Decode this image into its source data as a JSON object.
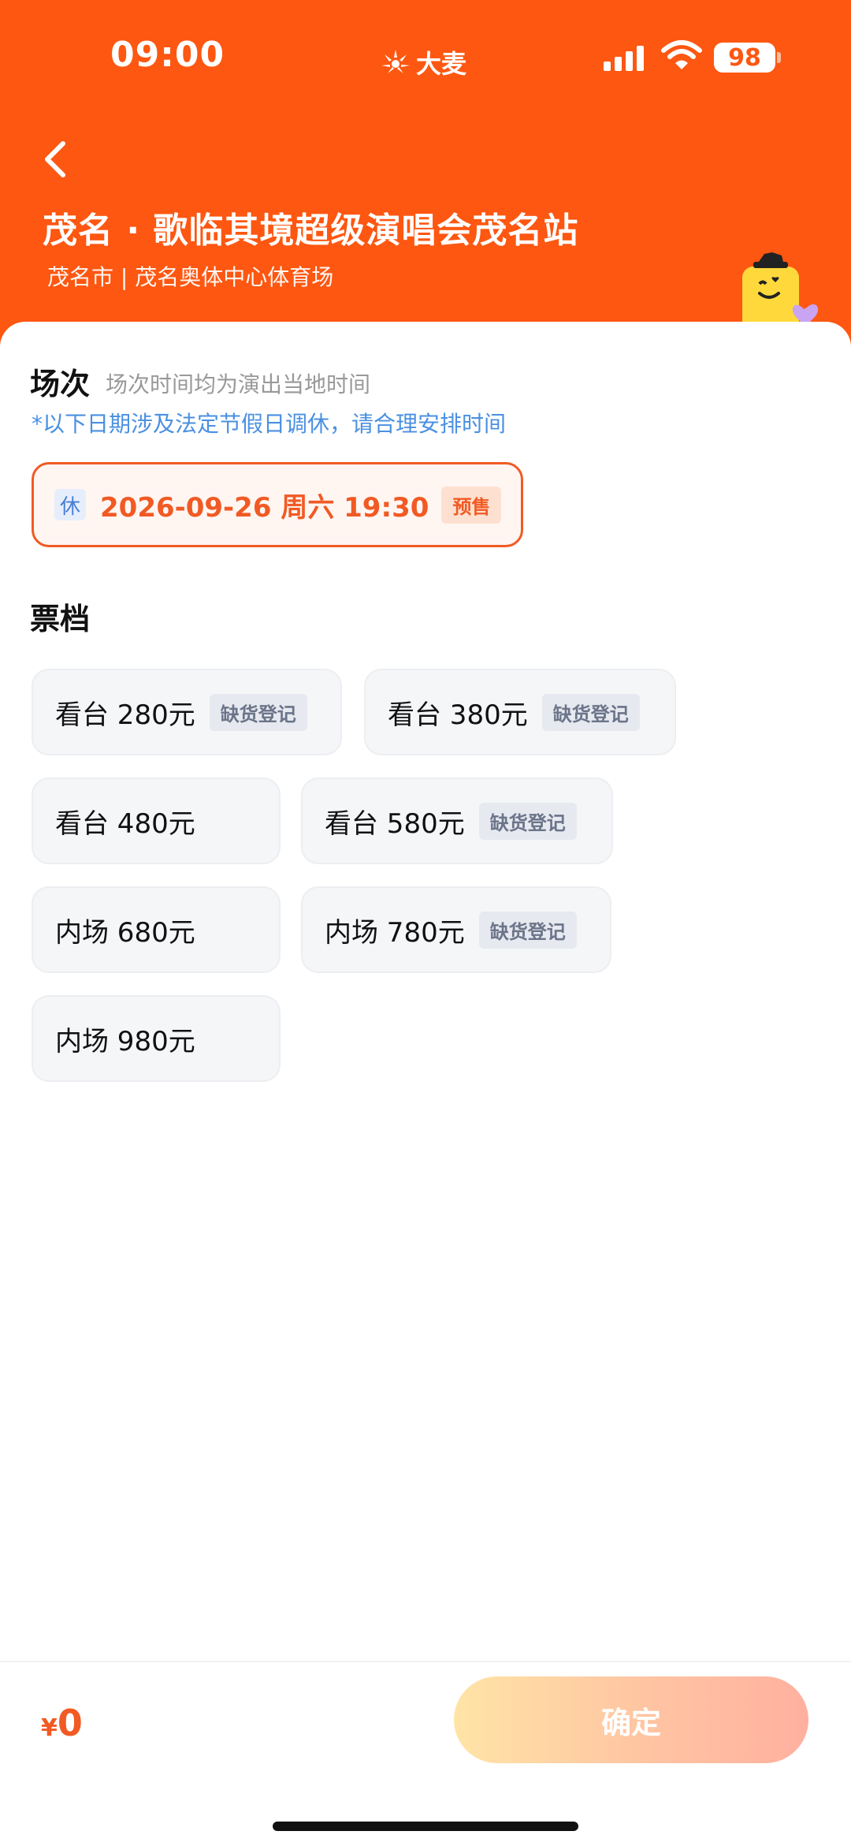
{
  "status_bar": {
    "time": "09:00",
    "brand": "大麦",
    "battery": "98"
  },
  "header": {
    "title": "茂名 · 歌临其境超级演唱会茂名站",
    "venue": "茂名市 | 茂名奥体中心体育场"
  },
  "session": {
    "section_title": "场次",
    "note": "场次时间均为演出当地时间",
    "holiday_note": "*以下日期涉及法定节假日调休，请合理安排时间",
    "rest_tag": "休",
    "datetime": "2026-09-26  周六 19:30",
    "presale_tag": "预售"
  },
  "tickets": {
    "section_title": "票档",
    "tiers": [
      {
        "label": "看台 280元",
        "tag": "缺货登记"
      },
      {
        "label": "看台 380元",
        "tag": "缺货登记"
      },
      {
        "label": "看台 480元",
        "tag": ""
      },
      {
        "label": "看台 580元",
        "tag": "缺货登记"
      },
      {
        "label": "内场 680元",
        "tag": ""
      },
      {
        "label": "内场 780元",
        "tag": "缺货登记"
      },
      {
        "label": "内场 980元",
        "tag": ""
      }
    ]
  },
  "footer": {
    "price_symbol": "¥",
    "price_value": "0",
    "confirm_label": "确定"
  },
  "colors": {
    "brand_orange": "#fd5711",
    "accent": "#f15a24",
    "link_blue": "#4a90e2"
  },
  "icons": [
    "back-icon",
    "damai-logo-icon",
    "signal-icon",
    "wifi-icon",
    "battery-icon",
    "mascot-icon"
  ]
}
